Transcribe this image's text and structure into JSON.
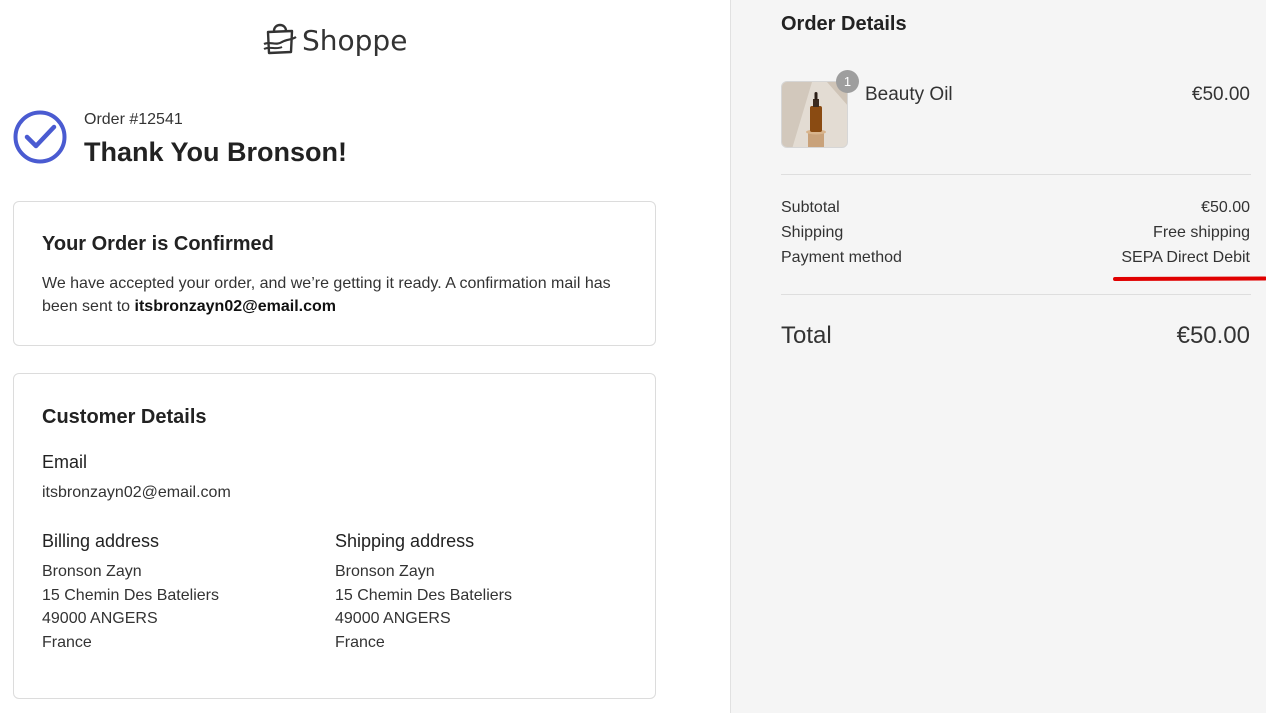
{
  "brand": {
    "name": "Shoppe",
    "icon": "shopping-bag-icon"
  },
  "header": {
    "status_icon": "check-circle-icon",
    "order_number": "Order #12541",
    "thank_you": "Thank You Bronson!"
  },
  "confirmation": {
    "title": "Your Order is Confirmed",
    "message": "We have accepted your order, and we’re getting it ready. A confirmation mail has been sent to",
    "email": "itsbronzayn02@email.com"
  },
  "customer": {
    "title": "Customer Details",
    "email_label": "Email",
    "email": "itsbronzayn02@email.com",
    "billing": {
      "label": "Billing address",
      "lines": [
        "Bronson Zayn",
        "15 Chemin Des Bateliers",
        "49000 ANGERS",
        "France"
      ]
    },
    "shipping": {
      "label": "Shipping address",
      "lines": [
        "Bronson Zayn",
        "15 Chemin Des Bateliers",
        "49000 ANGERS",
        "France"
      ]
    }
  },
  "order_details": {
    "title": "Order Details",
    "item": {
      "name": "Beauty Oil",
      "price": "€50.00",
      "quantity": "1"
    },
    "summary": [
      {
        "label": "Subtotal",
        "value": "€50.00"
      },
      {
        "label": "Shipping",
        "value": "Free shipping"
      },
      {
        "label": "Payment method",
        "value": "SEPA Direct Debit"
      }
    ],
    "total_label": "Total",
    "total_value": "€50.00"
  },
  "colors": {
    "accent": "#4a5bd1",
    "annotation": "#e00000",
    "panel": "#f5f5f5"
  }
}
